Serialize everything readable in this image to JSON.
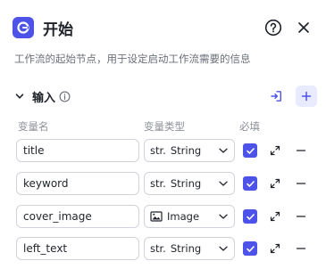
{
  "header": {
    "title": "开始",
    "icon": "flow-start-icon",
    "help_icon": "question-circle-icon",
    "close_icon": "close-icon"
  },
  "description": "工作流的起始节点，用于设定启动工作流需要的信息",
  "section": {
    "title": "输入",
    "info_icon": "info-icon",
    "import_icon": "import-icon",
    "add_icon": "plus-icon"
  },
  "columns": {
    "name": "变量名",
    "type": "变量类型",
    "required": "必填"
  },
  "rows": [
    {
      "name": "title",
      "type_prefix": "str.",
      "type": "String",
      "required": true
    },
    {
      "name": "keyword",
      "type_prefix": "str.",
      "type": "String",
      "required": true
    },
    {
      "name": "cover_image",
      "type_prefix": "",
      "type": "Image",
      "required": true
    },
    {
      "name": "left_text",
      "type_prefix": "str.",
      "type": "String",
      "required": true
    }
  ],
  "colors": {
    "accent": "#4d53e8",
    "accent_light": "#e8eaff"
  }
}
